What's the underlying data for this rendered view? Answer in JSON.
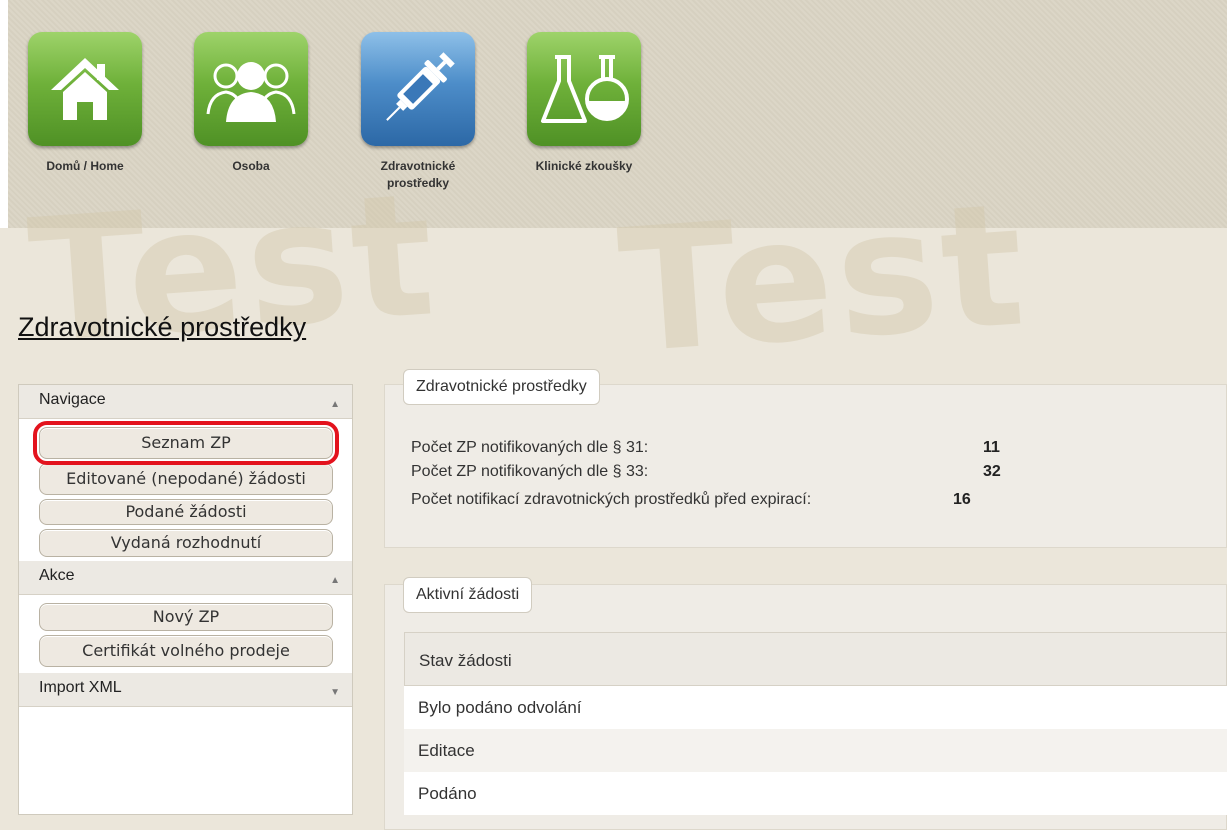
{
  "nav_tiles": [
    {
      "label": "Domů / Home",
      "icon": "house-icon",
      "color": "#6fb13a"
    },
    {
      "label": "Osoba",
      "icon": "people-icon",
      "color": "#6fb13a"
    },
    {
      "label": "Zdravotnické prostředky",
      "icon": "syringe-icon",
      "color": "#4d8dc9"
    },
    {
      "label": "Klinické zkoušky",
      "icon": "lab-flasks-icon",
      "color": "#6fb13a"
    }
  ],
  "watermark": "Test",
  "page_title": "Zdravotnické prostředky",
  "sidebar": {
    "sections": [
      {
        "title": "Navigace",
        "items": [
          "Seznam ZP",
          "Editované (nepodané) žádosti",
          "Podané žádosti",
          "Vydaná rozhodnutí"
        ]
      },
      {
        "title": "Akce",
        "items": [
          "Nový ZP",
          "Certifikát volného prodeje"
        ]
      },
      {
        "title": "Import XML",
        "items": []
      }
    ]
  },
  "summary": {
    "title": "Zdravotnické prostředky",
    "rows": [
      {
        "label": "Počet ZP notifikovaných dle § 31:",
        "value": "11"
      },
      {
        "label": "Počet ZP notifikovaných dle § 33:",
        "value": "32"
      },
      {
        "label": "Počet notifikací zdravotnických prostředků před expirací:",
        "value": "16"
      }
    ]
  },
  "active_requests": {
    "title": "Aktivní žádosti",
    "column": "Stav žádosti",
    "rows": [
      "Bylo podáno odvolání",
      "Editace",
      "Podáno"
    ]
  },
  "colors": {
    "highlight": "#e3131d",
    "tile_green": "#6fb13a",
    "tile_blue": "#4d8dc9"
  }
}
